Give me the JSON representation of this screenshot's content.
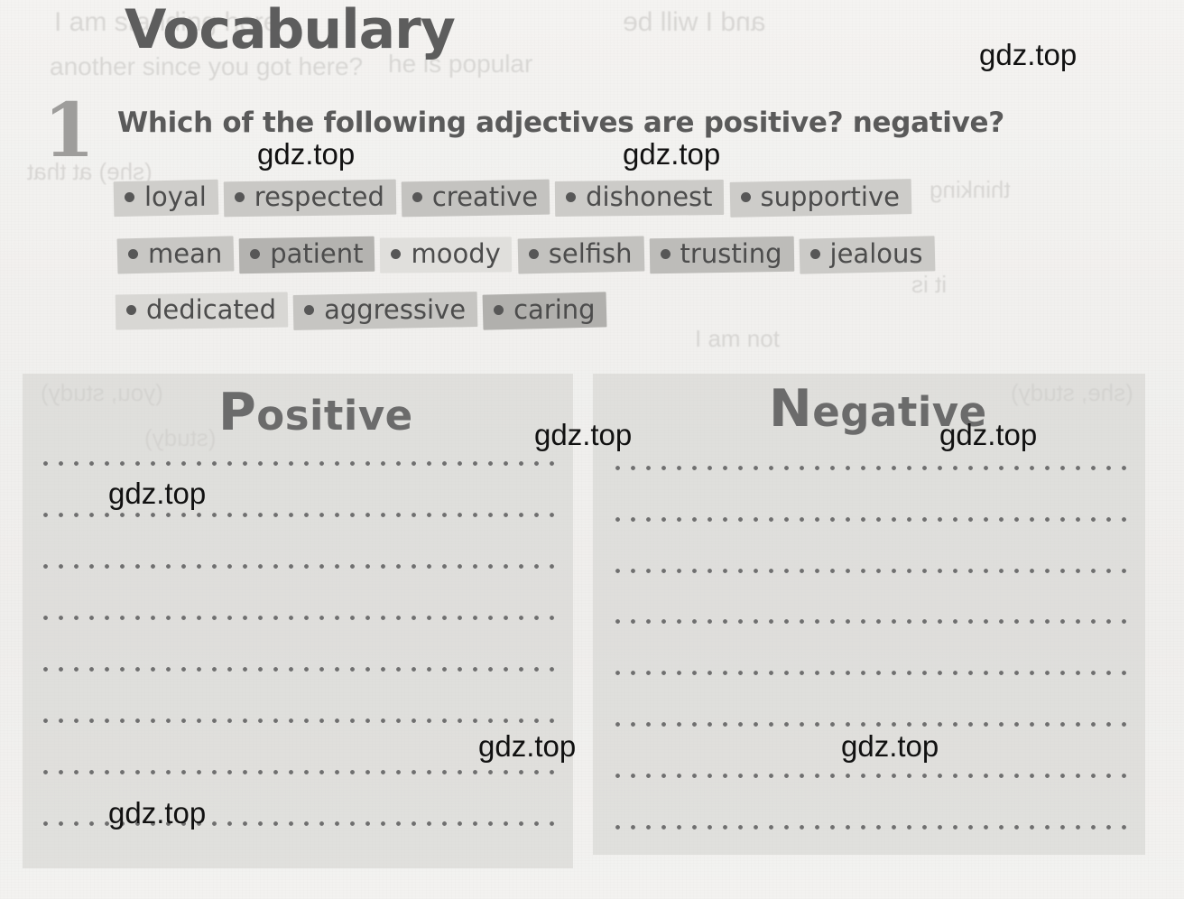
{
  "page": {
    "title": "Vocabulary",
    "background_color": "#f1f0ee",
    "text_color": "#5a5a5a"
  },
  "exercise": {
    "number": "1",
    "prompt": "Which of the following adjectives are positive? negative?"
  },
  "word_bank": {
    "rows": [
      [
        {
          "word": "loyal",
          "band": "#cfcecb"
        },
        {
          "word": "respected",
          "band": "#c9c8c5"
        },
        {
          "word": "creative",
          "band": "#c4c3c0"
        },
        {
          "word": "dishonest",
          "band": "#cccbc8"
        },
        {
          "word": "supportive",
          "band": "#cdccc9"
        }
      ],
      [
        {
          "word": "mean",
          "band": "#c8c7c4"
        },
        {
          "word": "patient",
          "band": "#b4b3b0"
        },
        {
          "word": "moody",
          "band": "#e0dfdc"
        },
        {
          "word": "selfish",
          "band": "#c3c2bf"
        },
        {
          "word": "trusting",
          "band": "#bdbcb9"
        },
        {
          "word": "jealous",
          "band": "#cbcac7"
        }
      ],
      [
        {
          "word": "dedicated",
          "band": "#d8d7d4"
        },
        {
          "word": "aggressive",
          "band": "#c6c5c2"
        },
        {
          "word": "caring",
          "band": "#b1b0ad"
        }
      ]
    ]
  },
  "answer_table": {
    "columns": [
      {
        "heading": "Positive",
        "initial": "P",
        "rest": "ositive",
        "lines": 8
      },
      {
        "heading": "Negative",
        "initial": "N",
        "rest": "egative",
        "lines": 8
      }
    ]
  },
  "watermarks": [
    {
      "text": "gdz.top"
    },
    {
      "text": "gdz.top"
    },
    {
      "text": "gdz.top"
    },
    {
      "text": "gdz.top"
    },
    {
      "text": "gdz.top"
    },
    {
      "text": "gdz.top"
    },
    {
      "text": "gdz.top"
    },
    {
      "text": "gdz.top"
    }
  ],
  "show_through": [
    {
      "text": "I am standing here"
    },
    {
      "text": "another since you got here?"
    },
    {
      "text": "and I will be"
    },
    {
      "text": "he is popular"
    },
    {
      "text": "(she) at that"
    },
    {
      "text": "thinking"
    },
    {
      "text": "it is"
    },
    {
      "text": "I am not"
    },
    {
      "text": "(you, study)"
    },
    {
      "text": "(she, study)"
    },
    {
      "text": "(study)"
    }
  ]
}
